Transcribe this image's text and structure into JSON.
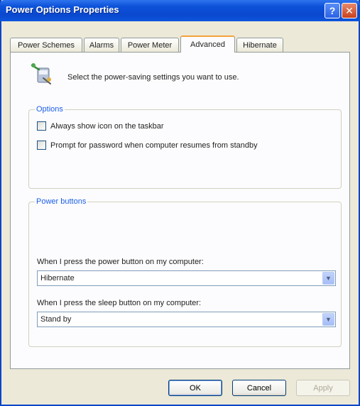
{
  "window": {
    "title": "Power Options Properties",
    "help_button": "?",
    "close_button": "✕"
  },
  "tabs": [
    {
      "label": "Power Schemes",
      "active": false
    },
    {
      "label": "Alarms",
      "active": false
    },
    {
      "label": "Power Meter",
      "active": false
    },
    {
      "label": "Advanced",
      "active": true
    },
    {
      "label": "Hibernate",
      "active": false
    }
  ],
  "advanced": {
    "header_text": "Select the power-saving settings you want to use.",
    "header_icon": "power-settings-icon",
    "options_group": {
      "legend": "Options",
      "checkboxes": [
        {
          "label": "Always show icon on the taskbar",
          "checked": false
        },
        {
          "label": "Prompt for password when computer resumes from standby",
          "checked": false
        }
      ]
    },
    "power_buttons_group": {
      "legend": "Power buttons",
      "power_button_label": "When I press the power button on my computer:",
      "power_button_value": "Hibernate",
      "sleep_button_label": "When I press the sleep button on my computer:",
      "sleep_button_value": "Stand by"
    }
  },
  "buttons": {
    "ok": "OK",
    "cancel": "Cancel",
    "apply": "Apply"
  },
  "colors": {
    "titlebar": "#0a48cf",
    "group_legend": "#1b5ee6",
    "active_tab_accent": "#f3a43a"
  }
}
